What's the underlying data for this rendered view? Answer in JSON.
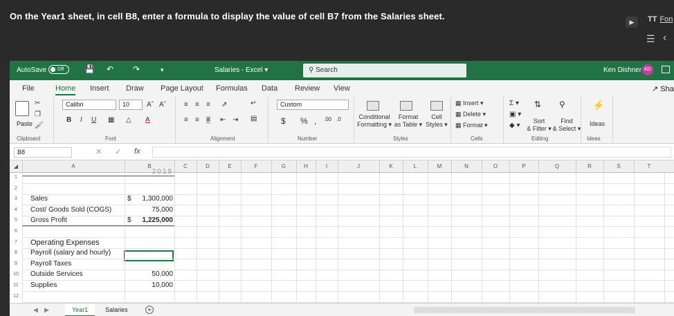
{
  "instruction": "On the Year1 sheet, in cell B8, enter a formula to display the value of cell B7 from the Salaries sheet.",
  "overlay": {
    "font_label": "Fon",
    "font_prefix": "TT"
  },
  "titlebar": {
    "autosave": "AutoSave",
    "autosave_state": "Off",
    "title": "Salaries - Excel ▾",
    "search_placeholder": "Search",
    "user": "Ken Dishner",
    "avatar_initials": "KD"
  },
  "tabs": [
    "File",
    "Home",
    "Insert",
    "Draw",
    "Page Layout",
    "Formulas",
    "Data",
    "Review",
    "View"
  ],
  "share_label": "Sha",
  "ribbon": {
    "paste": "Paste",
    "font_name": "Calibri",
    "font_size": "10",
    "number_format": "Custom",
    "conditional": "Conditional",
    "formatting": "Formatting ▾",
    "format_table_1": "Format",
    "format_table_2": "as Table ▾",
    "cell_styles_1": "Cell",
    "cell_styles_2": "Styles ▾",
    "insert": "Insert",
    "delete": "Delete",
    "format": "Format",
    "sort_1": "Sort",
    "sort_2": "& Filter ▾",
    "find_1": "Find",
    "find_2": "& Select ▾",
    "ideas": "Ideas",
    "groups": {
      "clipboard": "Clipboard",
      "font": "Font",
      "alignment": "Alignment",
      "number": "Number",
      "styles": "Styles",
      "cells": "Cells",
      "editing": "Editing",
      "ideas": "Ideas"
    }
  },
  "formula_bar": {
    "name_box": "B8",
    "formula": ""
  },
  "columns": [
    "A",
    "B",
    "C",
    "D",
    "E",
    "F",
    "G",
    "H",
    "I",
    "J",
    "K",
    "L",
    "M",
    "N",
    "O",
    "P",
    "Q",
    "R",
    "S",
    "T"
  ],
  "rows": [
    {
      "num": "1",
      "a": "",
      "b": "2019"
    },
    {
      "num": "2",
      "a": "",
      "b": ""
    },
    {
      "num": "3",
      "a": "Sales",
      "b_sym": "$",
      "b": "1,300,000"
    },
    {
      "num": "4",
      "a": "Cost/ Goods Sold (COGS)",
      "b": "75,000"
    },
    {
      "num": "5",
      "a": "Gross Profit",
      "b_sym": "$",
      "b": "1,225,000"
    },
    {
      "num": "6",
      "a": "",
      "b": ""
    },
    {
      "num": "7",
      "a": "Operating Expenses",
      "b": ""
    },
    {
      "num": "8",
      "a": "Payroll (salary and hourly)",
      "b": ""
    },
    {
      "num": "9",
      "a": "Payroll Taxes",
      "b": ""
    },
    {
      "num": "10",
      "a": "Outside Services",
      "b": "50,000"
    },
    {
      "num": "11",
      "a": "Supplies",
      "b": "10,000"
    },
    {
      "num": "12",
      "a": "",
      "b": ""
    }
  ],
  "sheets": [
    "Year1",
    "Salaries"
  ],
  "active_sheet": "Year1",
  "colors": {
    "excel_green": "#217346",
    "banner_bg": "#2a2a2a"
  }
}
